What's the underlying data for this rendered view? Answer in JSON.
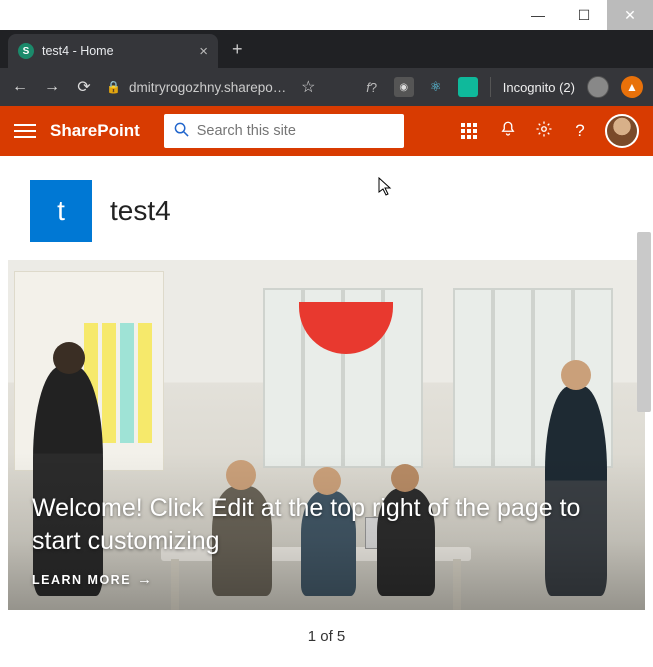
{
  "browser": {
    "tab_title": "test4 - Home",
    "url_display": "dmitryrogozhny.sharepo…",
    "incognito_label": "Incognito (2)"
  },
  "suite": {
    "brand": "SharePoint",
    "search_placeholder": "Search this site"
  },
  "site": {
    "logo_letter": "t",
    "title": "test4"
  },
  "hero": {
    "title": "Welcome! Click Edit at the top right of the page to start customizing",
    "cta": "LEARN MORE"
  },
  "pager": {
    "text": "1 of 5"
  },
  "colors": {
    "brand": "#d83b01",
    "site_logo": "#0078d4"
  }
}
